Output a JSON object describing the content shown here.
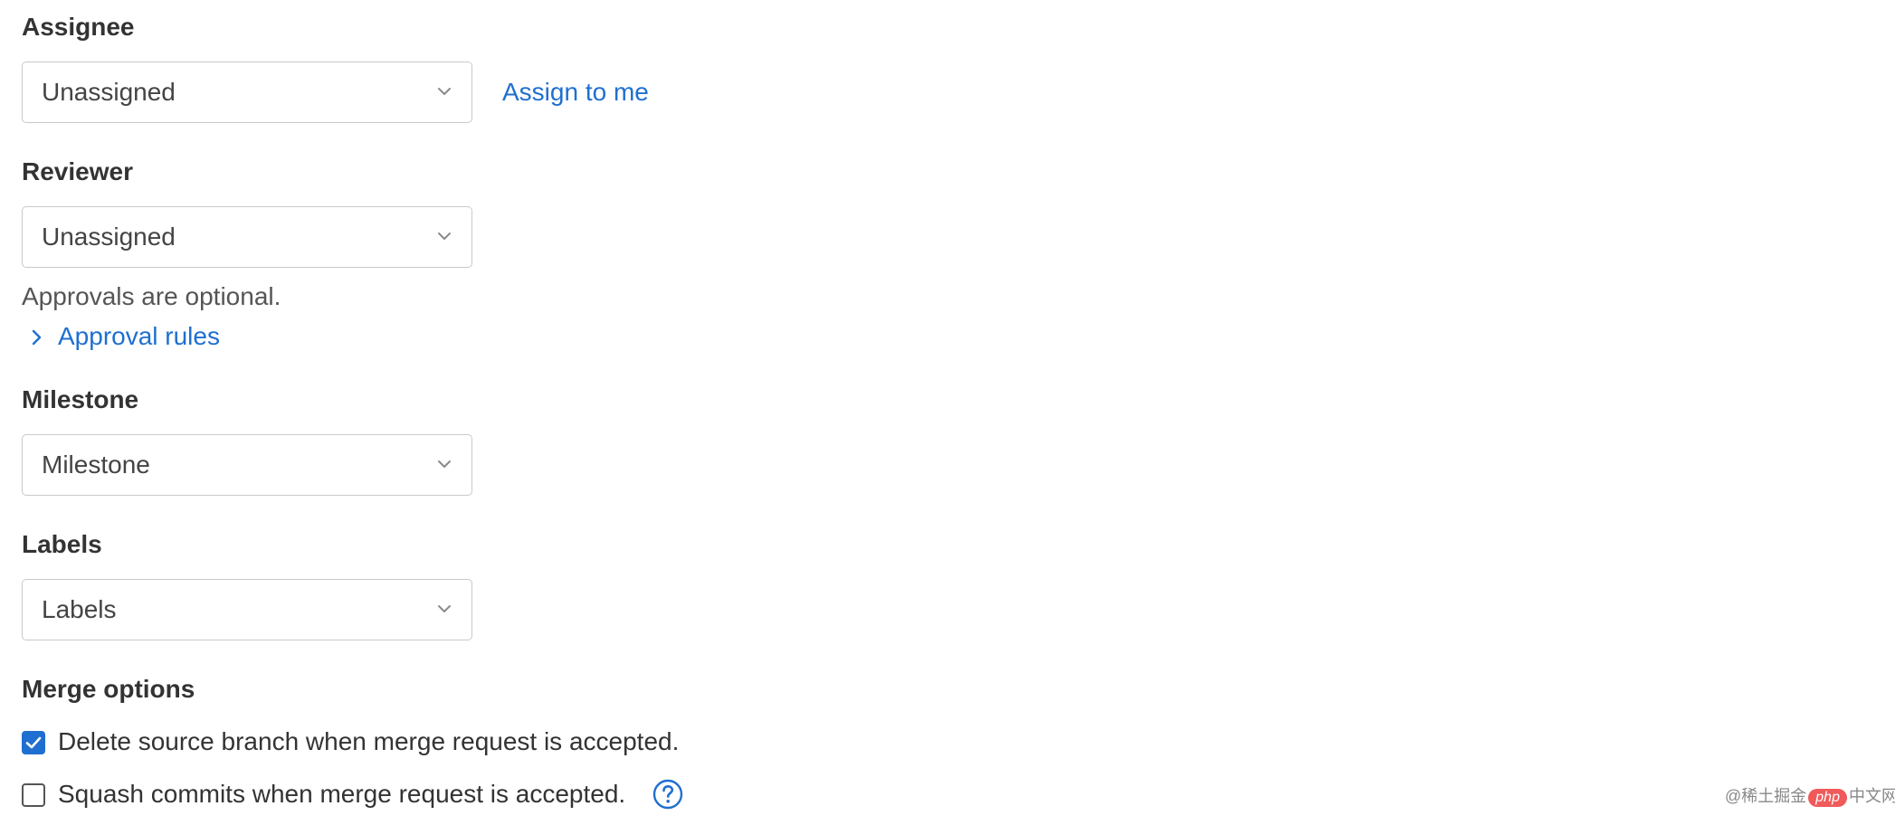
{
  "assignee": {
    "title": "Assignee",
    "select_value": "Unassigned",
    "assign_to_me_link": "Assign to me"
  },
  "reviewer": {
    "title": "Reviewer",
    "select_value": "Unassigned",
    "approvals_note": "Approvals are optional.",
    "approval_rules_link": "Approval rules"
  },
  "milestone": {
    "title": "Milestone",
    "select_value": "Milestone"
  },
  "labels": {
    "title": "Labels",
    "select_value": "Labels"
  },
  "merge_options": {
    "title": "Merge options",
    "delete_source_branch": {
      "label": "Delete source branch when merge request is accepted.",
      "checked": true
    },
    "squash_commits": {
      "label": "Squash commits when merge request is accepted.",
      "checked": false
    }
  },
  "watermark": {
    "prefix": "@稀土掘金",
    "badge": "php",
    "suffix": "中文网"
  },
  "colors": {
    "link": "#1f6fd0",
    "checkbox_checked": "#1f6fd0",
    "select_border": "#c9c9cc",
    "heading_text": "#333333"
  },
  "icons": {
    "select_caret": "chevron-down-icon",
    "approval_toggle": "chevron-right-icon",
    "squash_help": "question-circle-icon",
    "checkmark": "check-icon"
  }
}
